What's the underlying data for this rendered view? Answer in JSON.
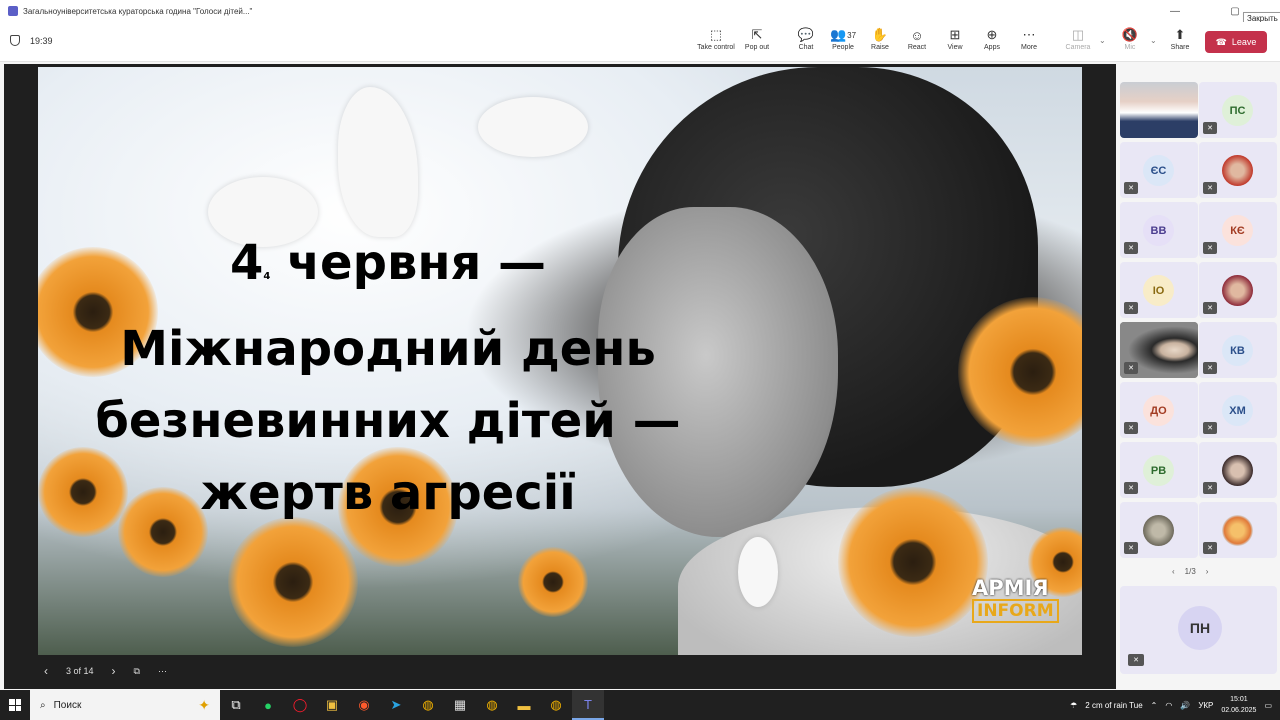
{
  "window": {
    "title": "Загальноуніверситетська кураторська година \"Голоси дітей...\"",
    "tooltip": "Закрыть",
    "minimize": "—",
    "maximize": "▢",
    "close": "✕"
  },
  "meeting": {
    "timer": "19:39",
    "toolbar": [
      {
        "label": "Take control",
        "icon": "take-control-icon",
        "glyph": "⬚"
      },
      {
        "label": "Pop out",
        "icon": "pop-out-icon",
        "glyph": "⇱"
      },
      {
        "label": "Chat",
        "icon": "chat-icon",
        "glyph": "💬"
      },
      {
        "label": "People",
        "icon": "people-icon",
        "glyph": "👥",
        "count": "37"
      },
      {
        "label": "Raise",
        "icon": "hand-icon",
        "glyph": "✋"
      },
      {
        "label": "React",
        "icon": "react-icon",
        "glyph": "☺"
      },
      {
        "label": "View",
        "icon": "view-icon",
        "glyph": "⊞"
      },
      {
        "label": "Apps",
        "icon": "apps-icon",
        "glyph": "⊕"
      },
      {
        "label": "More",
        "icon": "more-icon",
        "glyph": "⋯"
      },
      {
        "label": "Camera",
        "icon": "camera-off-icon",
        "glyph": "◫",
        "disabled": true
      },
      {
        "label": "Mic",
        "icon": "mic-off-icon",
        "glyph": "🔇",
        "disabled": true
      },
      {
        "label": "Share",
        "icon": "share-icon",
        "glyph": "⬆"
      }
    ],
    "leave_label": "Leave",
    "leave_color": "#c4314b"
  },
  "slide": {
    "line1": "4",
    "line1_sub": "4",
    "line1_rest": "червня —",
    "line2": "Міжнародний день",
    "line3": "безневинних дітей —",
    "line4": "жертв агресії",
    "watermark_top": "АРМІЯ",
    "watermark_bottom": "INFORM",
    "counter": "3 of 14"
  },
  "participants": [
    {
      "initials": "",
      "photo": true,
      "bg": "#c9cdd3"
    },
    {
      "initials": "ПС",
      "bg": "#dff0d8",
      "fg": "#2e6b2e"
    },
    {
      "initials": "ЄС",
      "bg": "#dbe7f7",
      "fg": "#2b4f8a"
    },
    {
      "initials": "",
      "photo": true,
      "bg": "#f3e3e6"
    },
    {
      "initials": "ВВ",
      "bg": "#e6e0f7",
      "fg": "#4b3d8f"
    },
    {
      "initials": "КЄ",
      "bg": "#fbe2dc",
      "fg": "#a23b22"
    },
    {
      "initials": "ІО",
      "bg": "#f8ecc8",
      "fg": "#8a6a12"
    },
    {
      "initials": "",
      "photo": true,
      "bg": "#e9e2d7"
    },
    {
      "initials": "",
      "photo": true,
      "bg": "#6b6b6b"
    },
    {
      "initials": "КВ",
      "bg": "#dbe7f7",
      "fg": "#2b4f8a"
    },
    {
      "initials": "ДО",
      "bg": "#fbe2dc",
      "fg": "#a23b22"
    },
    {
      "initials": "ХМ",
      "bg": "#dbe7f7",
      "fg": "#2b4f8a"
    },
    {
      "initials": "РВ",
      "bg": "#dff0d8",
      "fg": "#2e6b2e"
    },
    {
      "initials": "",
      "photo": true,
      "bg": "#ece8ef"
    },
    {
      "initials": "",
      "photo": true,
      "bg": "#d5d3c9"
    },
    {
      "initials": "",
      "photo": true,
      "bg": "#d6e6f3"
    }
  ],
  "gallery_pager": {
    "prev": "‹",
    "label": "1/3",
    "next": "›"
  },
  "featured": {
    "initials": "ПН"
  },
  "taskbar": {
    "search_label": "Поиск",
    "apps": [
      "task-view-icon",
      "whatsapp-icon",
      "opera-icon",
      "explorer-icon",
      "yandex-icon",
      "telegram-icon",
      "chrome-icon",
      "media-icon",
      "chrome-icon-2",
      "files-icon",
      "chrome-icon-3",
      "teams-icon"
    ],
    "weather": "2 cm of rain Tue",
    "lang": "УКР",
    "time": "15:01",
    "date": "02.06.2025"
  }
}
